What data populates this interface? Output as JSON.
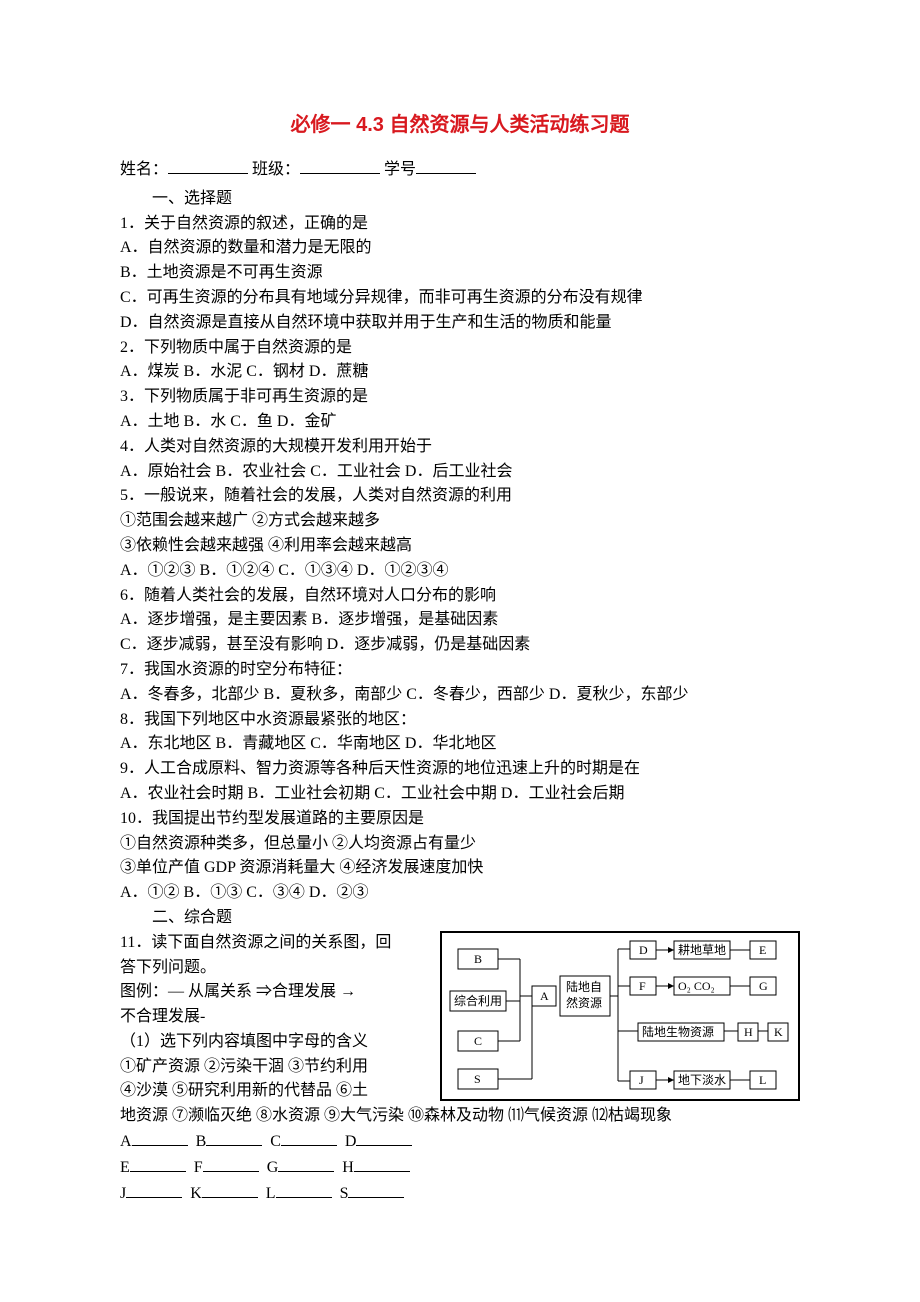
{
  "title": "必修一 4.3 自然资源与人类活动练习题",
  "info": {
    "name_label": "姓名：",
    "class_label": "班级：",
    "id_label": "学号"
  },
  "section1": "一、选择题",
  "q1": {
    "stem": "1．关于自然资源的叙述，正确的是",
    "A": "A．自然资源的数量和潜力是无限的",
    "B": "B．土地资源是不可再生资源",
    "C": "C．可再生资源的分布具有地域分异规律，而非可再生资源的分布没有规律",
    "D": "D．自然资源是直接从自然环境中获取并用于生产和生活的物质和能量"
  },
  "q2": {
    "stem": "2．下列物质中属于自然资源的是",
    "opts": "A．煤炭 B．水泥 C．钢材 D．蔗糖"
  },
  "q3": {
    "stem": "3．下列物质属于非可再生资源的是",
    "opts": "A．土地 B．水   C．鱼   D．金矿"
  },
  "q4": {
    "stem": "4．人类对自然资源的大规模开发利用开始于",
    "opts": "A．原始社会 B．农业社会 C．工业社会 D．后工业社会"
  },
  "q5": {
    "stem": "5．一般说来，随着社会的发展，人类对自然资源的利用",
    "l1": "①范围会越来越广            ②方式会越来越多",
    "l2": "③依赖性会越来越强          ④利用率会越来越高",
    "opts": "A．①②③   B．①②④   C．①③④   D．①②③④"
  },
  "q6": {
    "stem": "6．随着人类社会的发展，自然环境对人口分布的影响",
    "l1": "A．逐步增强，是主要因素         B．逐步增强，是基础因素",
    "l2": "C．逐步减弱，甚至没有影响       D．逐步减弱，仍是基础因素"
  },
  "q7": {
    "stem": "7．我国水资源的时空分布特征：",
    "opts": "A．冬春多，北部少   B．夏秋多，南部少   C．冬春少，西部少   D．夏秋少，东部少"
  },
  "q8": {
    "stem": "8．我国下列地区中水资源最紧张的地区：",
    "opts": "A．东北地区     B．青藏地区     C．华南地区  D．华北地区"
  },
  "q9": {
    "stem": "9．人工合成原料、智力资源等各种后天性资源的地位迅速上升的时期是在",
    "opts": "A．农业社会时期    B．工业社会初期    C．工业社会中期    D．工业社会后期"
  },
  "q10": {
    "stem": "10．我国提出节约型发展道路的主要原因是",
    "l1": "①自然资源种类多，但总量小       ②人均资源占有量少",
    "l2": "③单位产值 GDP 资源消耗量大       ④经济发展速度加快",
    "opts": "A．①②      B．①③     C．③④     D．②③"
  },
  "section2": "二、综合题",
  "q11": {
    "stem1": "11．读下面自然资源之间的关系图，回",
    "stem2": "答下列问题。",
    "legend_a": "图例：— 从属关系   ⇒合理发展   →",
    "legend_b": "不合理发展-",
    "sub1": "（1）选下列内容填图中字母的含义",
    "list1": "①矿产资源   ②污染干涸   ③节约利用",
    "list2": "④沙漠  ⑤研究利用新的代替品   ⑥土",
    "list3": "地资源   ⑦濒临灭绝   ⑧水资源   ⑨大气污染   ⑩森林及动物   ⑾气候资源 ⑿枯竭现象"
  },
  "answers": {
    "r1": [
      "A",
      "B",
      "C",
      "D"
    ],
    "r2": [
      "E",
      "F",
      "G",
      "H"
    ],
    "r3": [
      "J",
      "K",
      "L",
      "S"
    ]
  },
  "diagram": {
    "B": "B",
    "C": "C",
    "S": "S",
    "A": "A",
    "zhly": "综合利用",
    "ldzy": "陆地自\n然资源",
    "D": "D",
    "F": "F",
    "J": "J",
    "gdcd": "耕地草地",
    "o2co2": "O₂ CO₂",
    "ldsw": "陆地生物资源",
    "dxds": "地下淡水",
    "E": "E",
    "G": "G",
    "H": "H",
    "K": "K",
    "L": "L"
  }
}
